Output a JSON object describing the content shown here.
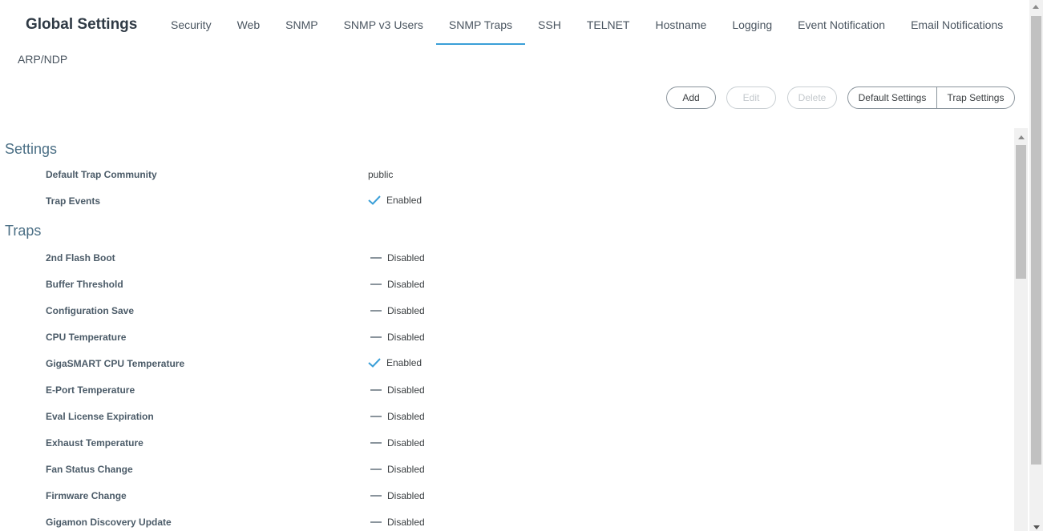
{
  "header": {
    "title": "Global Settings",
    "tabs": [
      {
        "label": "Security"
      },
      {
        "label": "Web"
      },
      {
        "label": "SNMP"
      },
      {
        "label": "SNMP v3 Users"
      },
      {
        "label": "SNMP Traps",
        "active": true
      },
      {
        "label": "SSH"
      },
      {
        "label": "TELNET"
      },
      {
        "label": "Hostname"
      },
      {
        "label": "Logging"
      },
      {
        "label": "Event Notification"
      },
      {
        "label": "Email Notifications"
      }
    ],
    "tab_row2": "ARP/NDP",
    "accent_color": "#3a9fd8"
  },
  "toolbar": {
    "add": "Add",
    "edit": "Edit",
    "delete": "Delete",
    "default_settings": "Default Settings",
    "trap_settings": "Trap Settings"
  },
  "settings": {
    "title": "Settings",
    "rows": [
      {
        "label": "Default Trap Community",
        "value": "public"
      },
      {
        "label": "Trap Events",
        "value": "Enabled",
        "icon": "check-icon"
      }
    ]
  },
  "traps": {
    "title": "Traps",
    "rows": [
      {
        "label": "2nd Flash Boot",
        "value": "Disabled",
        "icon": "dash-icon"
      },
      {
        "label": "Buffer Threshold",
        "value": "Disabled",
        "icon": "dash-icon"
      },
      {
        "label": "Configuration Save",
        "value": "Disabled",
        "icon": "dash-icon"
      },
      {
        "label": "CPU Temperature",
        "value": "Disabled",
        "icon": "dash-icon"
      },
      {
        "label": "GigaSMART CPU Temperature",
        "value": "Enabled",
        "icon": "check-icon"
      },
      {
        "label": "E-Port Temperature",
        "value": "Disabled",
        "icon": "dash-icon"
      },
      {
        "label": "Eval License Expiration",
        "value": "Disabled",
        "icon": "dash-icon"
      },
      {
        "label": "Exhaust Temperature",
        "value": "Disabled",
        "icon": "dash-icon"
      },
      {
        "label": "Fan Status Change",
        "value": "Disabled",
        "icon": "dash-icon"
      },
      {
        "label": "Firmware Change",
        "value": "Disabled",
        "icon": "dash-icon"
      },
      {
        "label": "Gigamon Discovery Update",
        "value": "Disabled",
        "icon": "dash-icon"
      }
    ]
  }
}
